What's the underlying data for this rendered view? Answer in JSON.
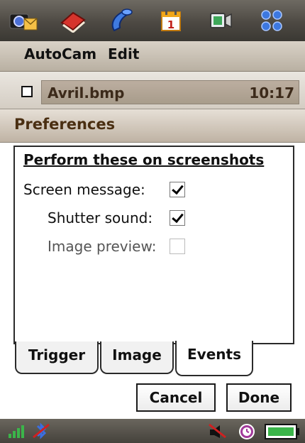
{
  "appbar": {
    "icons": [
      "camera-message-icon",
      "book-icon",
      "phone-icon",
      "calendar-icon",
      "media-player-icon",
      "menu-grid-icon"
    ],
    "calendar_day": "1"
  },
  "menu": {
    "items": [
      "AutoCam",
      "Edit"
    ]
  },
  "file": {
    "name": "Avril.bmp",
    "time": "10:17"
  },
  "preferences": {
    "title": "Preferences",
    "heading": "Perform these on screenshots",
    "options": [
      {
        "label": "Screen message:",
        "checked": true
      },
      {
        "label": "Shutter sound:",
        "checked": true
      },
      {
        "label": "Image preview:",
        "checked": false
      }
    ]
  },
  "tabs": [
    {
      "label": "Trigger",
      "active": false
    },
    {
      "label": "Image",
      "active": false
    },
    {
      "label": "Events",
      "active": true
    }
  ],
  "buttons": {
    "cancel": "Cancel",
    "done": "Done"
  },
  "status": {
    "icons": [
      "signal-strength-icon",
      "bluetooth-off-icon",
      "mute-icon",
      "alarm-clock-icon",
      "battery-icon"
    ]
  },
  "colors": {
    "title_text": "#4a2f12",
    "file_bar": "#a89c8b",
    "signal_green": "#3bb54a"
  }
}
